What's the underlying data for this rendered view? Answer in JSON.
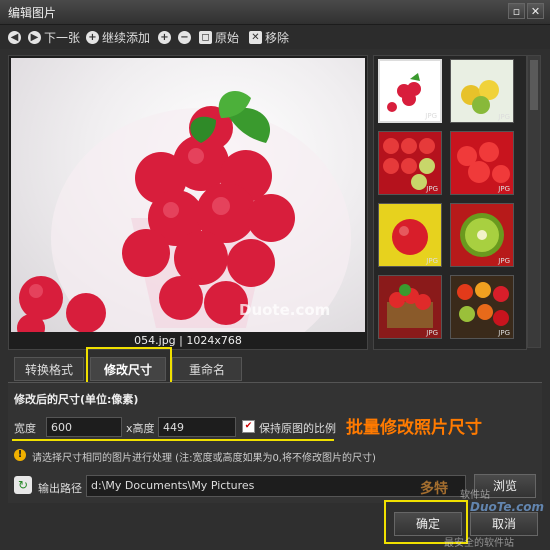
{
  "window": {
    "title": "编辑图片",
    "minimize_symbol": "▫",
    "close_symbol": "✕"
  },
  "toolbar": {
    "next_label": "下一张",
    "add_more_label": "继续添加",
    "original_label": "原始",
    "remove_label": "移除"
  },
  "preview": {
    "caption": "054.jpg | 1024x768",
    "watermark": "Duote.com"
  },
  "thumbnails": [
    {
      "tag": "JPG"
    },
    {
      "tag": "JPG"
    },
    {
      "tag": "JPG"
    },
    {
      "tag": "JPG"
    },
    {
      "tag": "JPG"
    },
    {
      "tag": "JPG"
    },
    {
      "tag": "JPG"
    },
    {
      "tag": "JPG"
    }
  ],
  "tabs": {
    "convert": "转换格式",
    "resize": "修改尺寸",
    "rename": "重命名"
  },
  "resize": {
    "section_title": "修改后的尺寸(单位:像素)",
    "width_label": "宽度",
    "width_value": "600",
    "height_label": "x高度",
    "height_value": "449",
    "keep_ratio_label": "保持原图的比例",
    "annotation": "批量修改照片尺寸",
    "note": "请选择尺寸相同的图片进行处理 (注:宽度或高度如果为0,将不修改图片的尺寸)"
  },
  "output": {
    "label": "输出路径",
    "path": "d:\\My Documents\\My Pictures",
    "browse_label": "浏览"
  },
  "footer": {
    "ok_label": "确定",
    "cancel_label": "取消",
    "site_brand": "多特",
    "site_sub": "软件站",
    "site_url": "DuoTe.com",
    "site_slogan": "最安全的软件站"
  }
}
